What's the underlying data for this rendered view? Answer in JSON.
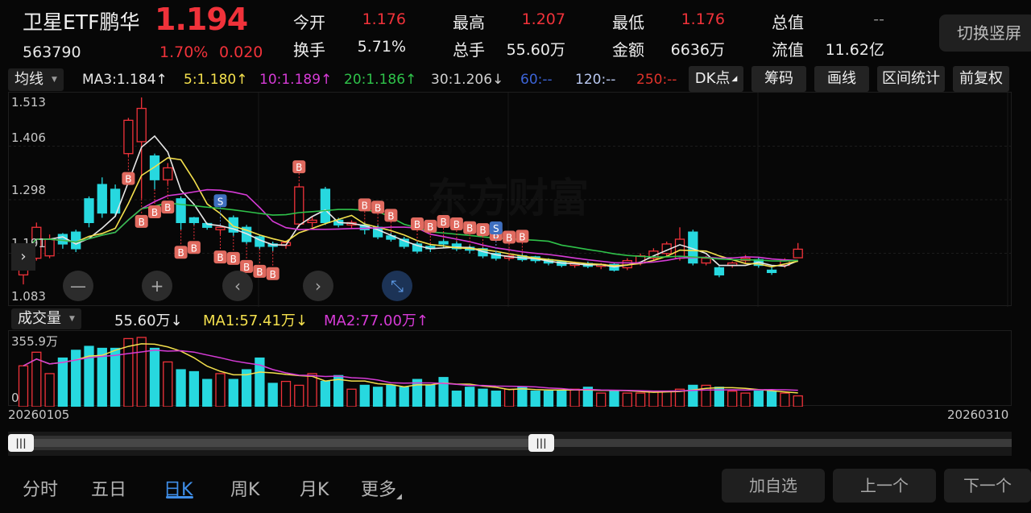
{
  "header": {
    "name": "卫星ETF鹏华",
    "price": "1.194",
    "code": "563790",
    "change_pct": "1.70%",
    "change_amt": "0.020",
    "stats": [
      {
        "label": "今开",
        "value": "1.176",
        "color": "red"
      },
      {
        "label": "最高",
        "value": "1.207",
        "color": "red"
      },
      {
        "label": "最低",
        "value": "1.176",
        "color": "red"
      },
      {
        "label": "总值",
        "value": "--",
        "color": "gray"
      },
      {
        "label": "换手",
        "value": "5.71%",
        "color": "white"
      },
      {
        "label": "总手",
        "value": "55.60万",
        "color": "white"
      },
      {
        "label": "金额",
        "value": "6636万",
        "color": "white"
      },
      {
        "label": "流值",
        "value": "11.62亿",
        "color": "white"
      }
    ],
    "switch_label": "切换竖屏"
  },
  "indicators": {
    "type_label": "均线",
    "ma": [
      {
        "text": "MA3:1.184↑",
        "color": "#e8e8e8"
      },
      {
        "text": "5:1.180↑",
        "color": "#f4e04d"
      },
      {
        "text": "10:1.189↑",
        "color": "#d63bd6"
      },
      {
        "text": "20:1.186↑",
        "color": "#2fc24a"
      },
      {
        "text": "30:1.206↓",
        "color": "#d0d0d0"
      },
      {
        "text": "60:--",
        "color": "#3c64d8"
      },
      {
        "text": "120:--",
        "color": "#b9c8f0"
      },
      {
        "text": "250:--",
        "color": "#e0332b"
      }
    ],
    "buttons": [
      "DK点",
      "筹码",
      "画线",
      "区间统计",
      "前复权"
    ]
  },
  "price_axis": [
    "1.513",
    "1.406",
    "1.298",
    "1.191",
    "1.083"
  ],
  "volume": {
    "type_label": "成交量",
    "current": "55.60万↓",
    "ma1": "MA1:57.41万↓",
    "ma2": "MA2:77.00万↑",
    "axis_top": "355.9万",
    "axis_bottom": "0"
  },
  "dates": {
    "start": "20260105",
    "end": "20260310"
  },
  "watermark": "东方财富",
  "tabs": [
    "分时",
    "五日",
    "日K",
    "周K",
    "月K",
    "更多"
  ],
  "active_tab": "日K",
  "bottom_buttons": [
    "加自选",
    "上一个",
    "下一个"
  ],
  "nav_icons": [
    "minus-icon",
    "plus-icon",
    "chevron-left-icon",
    "chevron-right-icon",
    "collapse-icon"
  ],
  "signals": {
    "buy": "B",
    "sell": "S"
  },
  "colors": {
    "up": "#f0323a",
    "down": "#27d8df",
    "ma3": "#e8e8e8",
    "ma5": "#f4e04d",
    "ma10": "#d63bd6",
    "ma20": "#2fc24a",
    "vol_ma1": "#f4e04d",
    "vol_ma2": "#d63bd6"
  },
  "chart_data": {
    "type": "candlestick",
    "x_start": "20260105",
    "x_end": "20260310",
    "ylim": [
      1.083,
      1.513
    ],
    "candles": [
      [
        1.14,
        1.19,
        1.12,
        1.195
      ],
      [
        1.175,
        1.24,
        1.17,
        1.25
      ],
      [
        1.18,
        1.215,
        1.175,
        1.225
      ],
      [
        1.225,
        1.205,
        1.195,
        1.228
      ],
      [
        1.23,
        1.195,
        1.188,
        1.235
      ],
      [
        1.3,
        1.25,
        1.24,
        1.305
      ],
      [
        1.33,
        1.27,
        1.26,
        1.345
      ],
      [
        1.32,
        1.27,
        1.262,
        1.33
      ],
      [
        1.395,
        1.465,
        1.39,
        1.47
      ],
      [
        1.42,
        1.49,
        1.3,
        1.513
      ],
      [
        1.39,
        1.34,
        1.32,
        1.395
      ],
      [
        1.34,
        1.365,
        1.33,
        1.375
      ],
      [
        1.3,
        1.25,
        1.235,
        1.305
      ],
      [
        1.26,
        1.25,
        1.245,
        1.262
      ],
      [
        1.248,
        1.24,
        1.235,
        1.25
      ],
      [
        1.235,
        1.24,
        1.225,
        1.245
      ],
      [
        1.26,
        1.23,
        1.222,
        1.265
      ],
      [
        1.24,
        1.21,
        1.205,
        1.245
      ],
      [
        1.22,
        1.2,
        1.195,
        1.225
      ],
      [
        1.205,
        1.2,
        1.19,
        1.21
      ],
      [
        1.202,
        1.208,
        1.195,
        1.212
      ],
      [
        1.247,
        1.325,
        1.24,
        1.33
      ],
      [
        1.25,
        1.255,
        1.24,
        1.262
      ],
      [
        1.32,
        1.25,
        1.245,
        1.325
      ],
      [
        1.255,
        1.245,
        1.24,
        1.26
      ],
      [
        1.245,
        1.25,
        1.238,
        1.255
      ],
      [
        1.245,
        1.235,
        1.225,
        1.25
      ],
      [
        1.24,
        1.22,
        1.215,
        1.245
      ],
      [
        1.222,
        1.215,
        1.21,
        1.228
      ],
      [
        1.215,
        1.2,
        1.195,
        1.22
      ],
      [
        1.205,
        1.19,
        1.185,
        1.21
      ],
      [
        1.2,
        1.195,
        1.188,
        1.205
      ],
      [
        1.21,
        1.205,
        1.198,
        1.215
      ],
      [
        1.205,
        1.195,
        1.19,
        1.21
      ],
      [
        1.198,
        1.192,
        1.185,
        1.202
      ],
      [
        1.195,
        1.18,
        1.175,
        1.198
      ],
      [
        1.185,
        1.175,
        1.17,
        1.188
      ],
      [
        1.175,
        1.18,
        1.17,
        1.182
      ],
      [
        1.18,
        1.172,
        1.168,
        1.184
      ],
      [
        1.178,
        1.17,
        1.165,
        1.18
      ],
      [
        1.172,
        1.165,
        1.16,
        1.175
      ],
      [
        1.168,
        1.16,
        1.156,
        1.17
      ],
      [
        1.16,
        1.165,
        1.155,
        1.168
      ],
      [
        1.164,
        1.158,
        1.154,
        1.168
      ],
      [
        1.158,
        1.162,
        1.152,
        1.165
      ],
      [
        1.162,
        1.15,
        1.147,
        1.165
      ],
      [
        1.155,
        1.17,
        1.15,
        1.175
      ],
      [
        1.165,
        1.18,
        1.16,
        1.185
      ],
      [
        1.175,
        1.19,
        1.17,
        1.196
      ],
      [
        1.185,
        1.205,
        1.18,
        1.21
      ],
      [
        1.175,
        1.215,
        1.17,
        1.24
      ],
      [
        1.23,
        1.165,
        1.16,
        1.235
      ],
      [
        1.165,
        1.175,
        1.16,
        1.18
      ],
      [
        1.155,
        1.14,
        1.135,
        1.158
      ],
      [
        1.16,
        1.165,
        1.155,
        1.168
      ],
      [
        1.17,
        1.175,
        1.165,
        1.182
      ],
      [
        1.172,
        1.16,
        1.155,
        1.176
      ],
      [
        1.15,
        1.145,
        1.14,
        1.16
      ],
      [
        1.16,
        1.17,
        1.155,
        1.175
      ],
      [
        1.176,
        1.194,
        1.176,
        1.207
      ]
    ],
    "volume_values": [
      2.1,
      2.8,
      1.7,
      2.5,
      2.9,
      3.1,
      3.0,
      3.0,
      3.5,
      3.559,
      3.0,
      2.3,
      1.9,
      1.8,
      1.4,
      1.7,
      1.4,
      1.9,
      2.5,
      1.2,
      1.3,
      1.1,
      1.7,
      1.3,
      1.6,
      0.9,
      1.1,
      1.0,
      1.1,
      1.0,
      1.4,
      1.1,
      1.5,
      0.8,
      1.0,
      0.9,
      0.8,
      0.9,
      1.0,
      0.8,
      0.8,
      0.8,
      0.9,
      1.0,
      0.7,
      0.8,
      0.7,
      0.7,
      0.8,
      0.8,
      0.9,
      1.1,
      1.1,
      1.0,
      0.8,
      0.7,
      0.8,
      0.8,
      0.7,
      0.556
    ]
  }
}
